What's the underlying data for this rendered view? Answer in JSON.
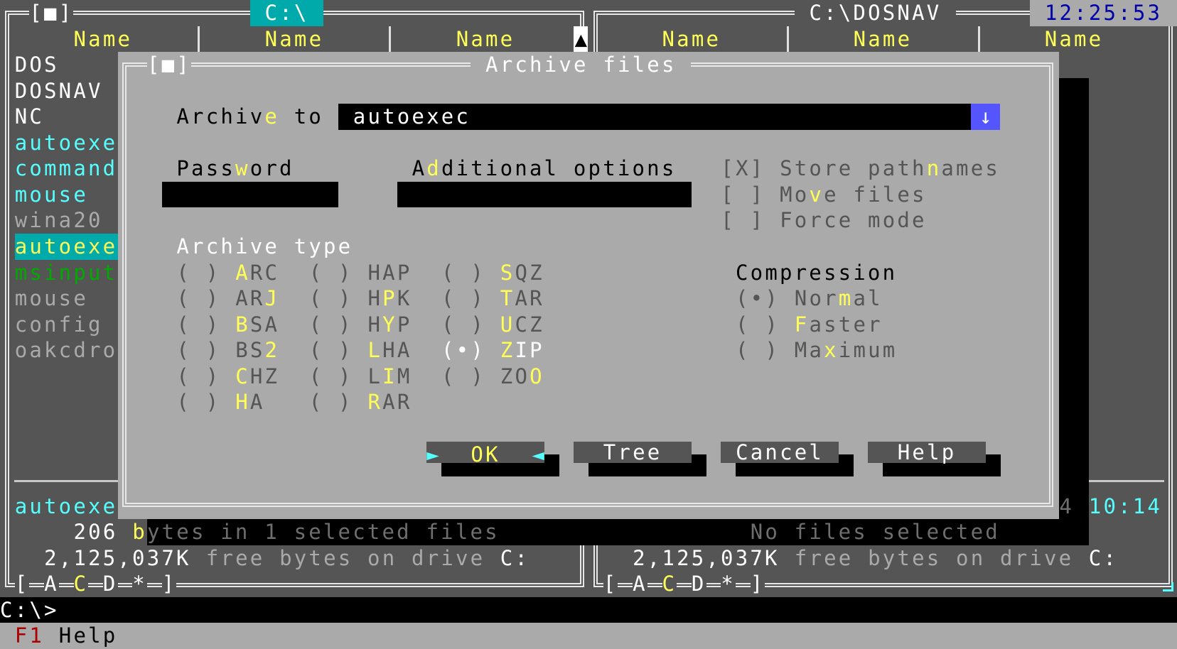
{
  "clock": "12:25:53",
  "left_panel": {
    "window_marker": "[■]",
    "path": " C:\\ ",
    "headers": [
      "Name",
      "Name",
      "Name"
    ],
    "scroll_up": "▲",
    "files": [
      {
        "name": "DOS",
        "kind": "directory"
      },
      {
        "name": "DOSNAV",
        "kind": "directory"
      },
      {
        "name": "NC",
        "kind": "directory"
      },
      {
        "name": "autoexe",
        "kind": "executable"
      },
      {
        "name": "command",
        "kind": "executable"
      },
      {
        "name": "mouse",
        "kind": "executable"
      },
      {
        "name": "wina20",
        "kind": "file"
      },
      {
        "name": "autoexe",
        "kind": "cursor"
      },
      {
        "name": "msinput",
        "kind": "archive"
      },
      {
        "name": "mouse",
        "kind": "file"
      },
      {
        "name": "config",
        "kind": "file"
      },
      {
        "name": "oakcdro",
        "kind": "file"
      }
    ],
    "info_name": "autoexe",
    "selected_bytes": "206",
    "selected_text": "bytes in 1 selected files",
    "selected_hotkey": 0,
    "free": "2,125,037K",
    "free_text": "free bytes on drive",
    "free_drive": "C:",
    "drives": [
      "[",
      "A",
      "C",
      "D",
      "*",
      "]"
    ],
    "active_drive": "C"
  },
  "right_panel": {
    "path": " C:\\DOSNAV ",
    "headers": [
      "Name",
      "Name",
      "Name"
    ],
    "info_size": "4",
    "info_time": "10:14",
    "selected_text": "No files selected",
    "free": "2,125,037K",
    "free_text": "free bytes on drive",
    "free_drive": "C:",
    "drives": [
      "[",
      "A",
      "C",
      "D",
      "*",
      "]"
    ]
  },
  "dialog": {
    "window_marker": "[■]",
    "title": " Archive files ",
    "archive_to": {
      "label": "Archive to",
      "hotkey": 6,
      "value": "autoexec",
      "dropdown_icon": "↓"
    },
    "password": {
      "label": "Password",
      "hotkey": 4,
      "value": ""
    },
    "additional": {
      "label": "Additional options",
      "hotkey": 1,
      "value": ""
    },
    "checkboxes": [
      {
        "mark": "[X]",
        "label": "Store pathnames",
        "hotkey": 10,
        "checked": true
      },
      {
        "mark": "[ ]",
        "label": "Move files",
        "hotkey": 2,
        "checked": false
      },
      {
        "mark": "[ ]",
        "label": "Force mode",
        "hotkey": -1,
        "checked": false
      }
    ],
    "archive_type_label": "Archive type",
    "archive_types": [
      {
        "mark": "( )",
        "label": "ARC",
        "hotkey": 0
      },
      {
        "mark": "( )",
        "label": "ARJ",
        "hotkey": 2
      },
      {
        "mark": "( )",
        "label": "BSA",
        "hotkey": 0
      },
      {
        "mark": "( )",
        "label": "BS2",
        "hotkey": 2
      },
      {
        "mark": "( )",
        "label": "CHZ",
        "hotkey": 0
      },
      {
        "mark": "( )",
        "label": "HA",
        "hotkey": 0
      },
      {
        "mark": "( )",
        "label": "HAP",
        "hotkey": -1
      },
      {
        "mark": "( )",
        "label": "HPK",
        "hotkey": 1
      },
      {
        "mark": "( )",
        "label": "HYP",
        "hotkey": 1
      },
      {
        "mark": "( )",
        "label": "LHA",
        "hotkey": 0
      },
      {
        "mark": "( )",
        "label": "LIM",
        "hotkey": 1
      },
      {
        "mark": "( )",
        "label": "RAR",
        "hotkey": 0
      },
      {
        "mark": "( )",
        "label": "SQZ",
        "hotkey": 0
      },
      {
        "mark": "( )",
        "label": "TAR",
        "hotkey": 0
      },
      {
        "mark": "( )",
        "label": "UCZ",
        "hotkey": 0
      },
      {
        "mark": "(•)",
        "label": "ZIP",
        "hotkey": 0,
        "selected": true
      },
      {
        "mark": "( )",
        "label": "ZOO",
        "hotkey": 2
      }
    ],
    "compression_label": "Compression",
    "compression": [
      {
        "mark": "(•)",
        "label": "Normal",
        "hotkey": 3,
        "selected": true
      },
      {
        "mark": "( )",
        "label": "Faster",
        "hotkey": 0
      },
      {
        "mark": "( )",
        "label": "Maximum",
        "hotkey": 2
      }
    ],
    "buttons": {
      "ok": "OK",
      "ok_left_marker": "►",
      "ok_right_marker": "◄",
      "tree": "Tree",
      "cancel": "Cancel",
      "help": "Help"
    }
  },
  "command_line": {
    "prompt": "C:\\>"
  },
  "status_bar": {
    "key": "F1",
    "label": "Help"
  },
  "colors": {
    "panel_bg": "#555555",
    "dialog_bg": "#aaaaaa",
    "hotkey": "#ffff55",
    "executable": "#55ffff",
    "cursor_bg": "#00aaaa",
    "dropdown_bg": "#5555ff",
    "clock_text": "#0000aa",
    "status_key": "#aa0000"
  }
}
